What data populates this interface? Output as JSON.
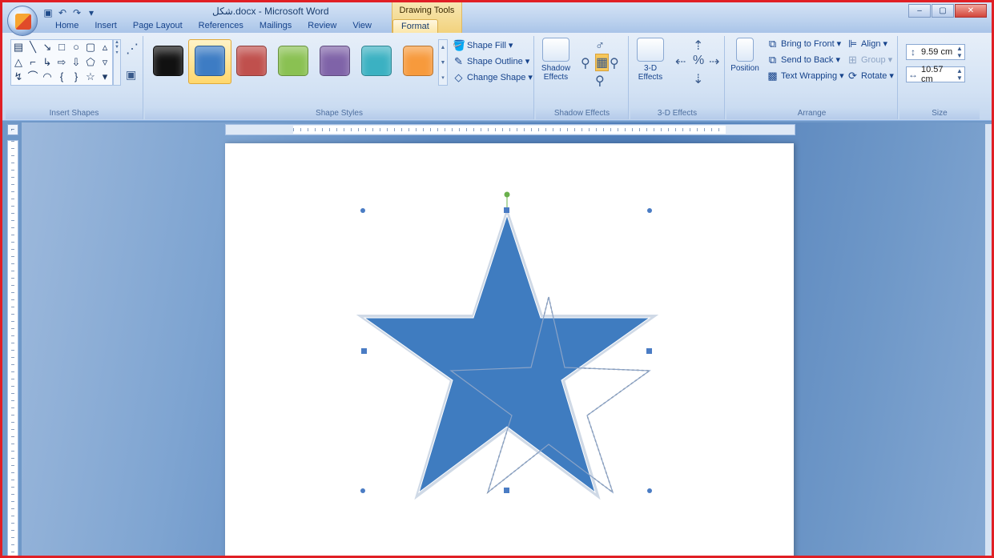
{
  "window": {
    "title": "شكل.docx - Microsoft Word",
    "context_tab_title": "Drawing Tools"
  },
  "tabs": [
    "Home",
    "Insert",
    "Page Layout",
    "References",
    "Mailings",
    "Review",
    "View",
    "Format"
  ],
  "active_tab": "Format",
  "ribbon": {
    "insert_shapes_label": "Insert Shapes",
    "shape_styles_label": "Shape Styles",
    "shape_style_colors": [
      "#111111",
      "#3d7cc4",
      "#c0504d",
      "#8ac152",
      "#7f63a8",
      "#3bb1c2",
      "#f79a3c"
    ],
    "selected_style_index": 1,
    "shape_fill": "Shape Fill",
    "shape_outline": "Shape Outline",
    "change_shape": "Change Shape",
    "shadow_effects_button": "Shadow Effects",
    "shadow_effects_label": "Shadow Effects",
    "effects_3d_button": "3-D Effects",
    "effects_3d_label": "3-D Effects",
    "position": "Position",
    "bring_to_front": "Bring to Front",
    "send_to_back": "Send to Back",
    "text_wrapping": "Text Wrapping",
    "align": "Align",
    "group": "Group",
    "rotate": "Rotate",
    "arrange_label": "Arrange",
    "height_value": "9.59 cm",
    "width_value": "10.57 cm",
    "size_label": "Size"
  },
  "colors": {
    "star_fill": "#3f7cc0",
    "frame_border": "#e01f25",
    "handle": "#4a7cc4",
    "rotate_handle": "#6ab04c"
  }
}
